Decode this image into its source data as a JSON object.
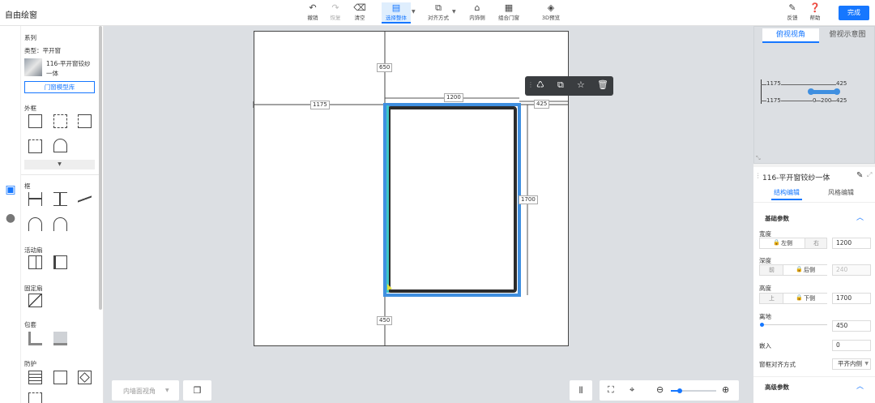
{
  "app": {
    "title": "自由绘窗"
  },
  "toolbar": {
    "undo": "撤销",
    "redo": "恢复",
    "clear": "清空",
    "select_all": "选择整体",
    "align": "对齐方式",
    "inner_outer": "内饰侧",
    "combine": "组合门窗",
    "preview": "3D预览"
  },
  "header_right": {
    "feedback": "反馈",
    "help": "帮助",
    "done": "完成"
  },
  "library": {
    "series_title": "系列",
    "type_line": "类型：平开窗",
    "product_name_1": "116-平开窗铰纱",
    "product_name_2": "一体",
    "lib_button": "门窗模型库",
    "outer_frame": "外框",
    "mullion": "框",
    "active_sash": "活动扇",
    "fixed_sash": "固定扇",
    "cladding": "包套",
    "protection": "防护"
  },
  "drawing": {
    "dim_top": "650",
    "dim_left": "1175",
    "dim_width": "1200",
    "dim_right": "425",
    "dim_height": "1700",
    "dim_bottom": "450"
  },
  "bottom": {
    "view_select": "内墙面视角"
  },
  "topview": {
    "tab_active": "俯视视角",
    "tab_other": "俯视示意图",
    "r1_left": "1175",
    "r1_right": "425",
    "r2_left": "1175",
    "r2_mid": "0",
    "r2_mid2": "200",
    "r2_right": "425"
  },
  "props": {
    "title": "116-平开窗铰纱一体",
    "tab_active": "结构编辑",
    "tab_other": "风格编辑",
    "basic": "基础参数",
    "width_label": "宽度",
    "left_side": "左侧",
    "right_side": "右",
    "width_value": "1200",
    "depth_label": "深度",
    "front": "前",
    "back_side": "后侧",
    "depth_value": "240",
    "height_label": "高度",
    "top": "上",
    "bottom_side": "下侧",
    "height_value": "1700",
    "sill_label": "离地",
    "sill_value": "450",
    "embed_label": "嵌入",
    "embed_value": "0",
    "align_label": "窗框对齐方式",
    "align_value": "平齐内侧",
    "advanced": "高级参数"
  },
  "colors": {
    "accent": "#1677ff",
    "frame": "#2b2b2b",
    "selection": "#3f8fe0"
  }
}
